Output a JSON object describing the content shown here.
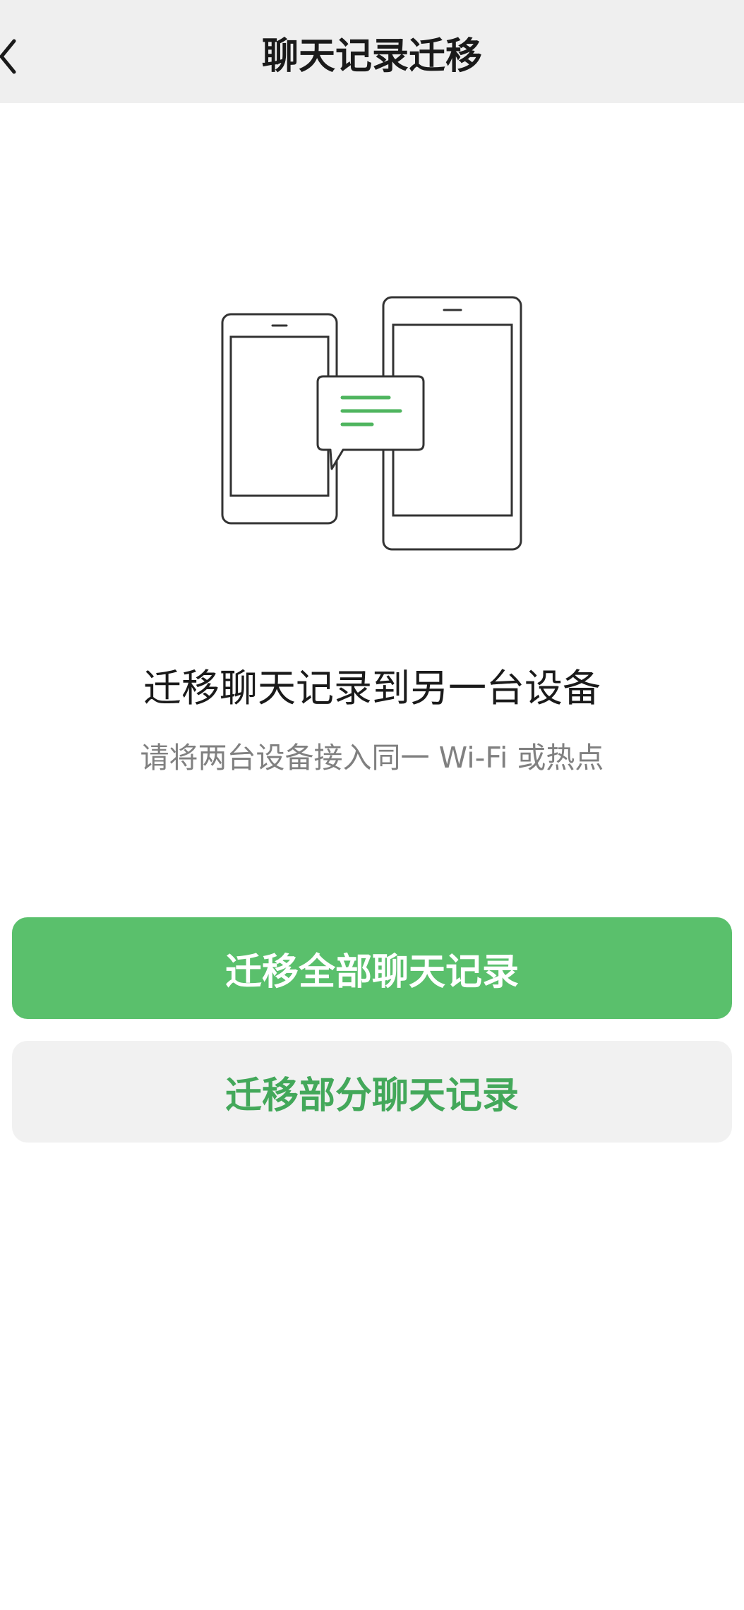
{
  "header": {
    "title": "聊天记录迁移",
    "back_icon": "chevron-left-icon"
  },
  "main": {
    "illustration_icon": "phone-to-tablet-transfer-icon",
    "heading": "迁移聊天记录到另一台设备",
    "subheading": "请将两台设备接入同一 Wi-Fi 或热点"
  },
  "actions": {
    "migrate_all_label": "迁移全部聊天记录",
    "migrate_partial_label": "迁移部分聊天记录"
  },
  "colors": {
    "accent_green": "#5ac06c",
    "secondary_text_green": "#43a85a",
    "header_bg": "#efefef",
    "muted_text": "#808080"
  }
}
